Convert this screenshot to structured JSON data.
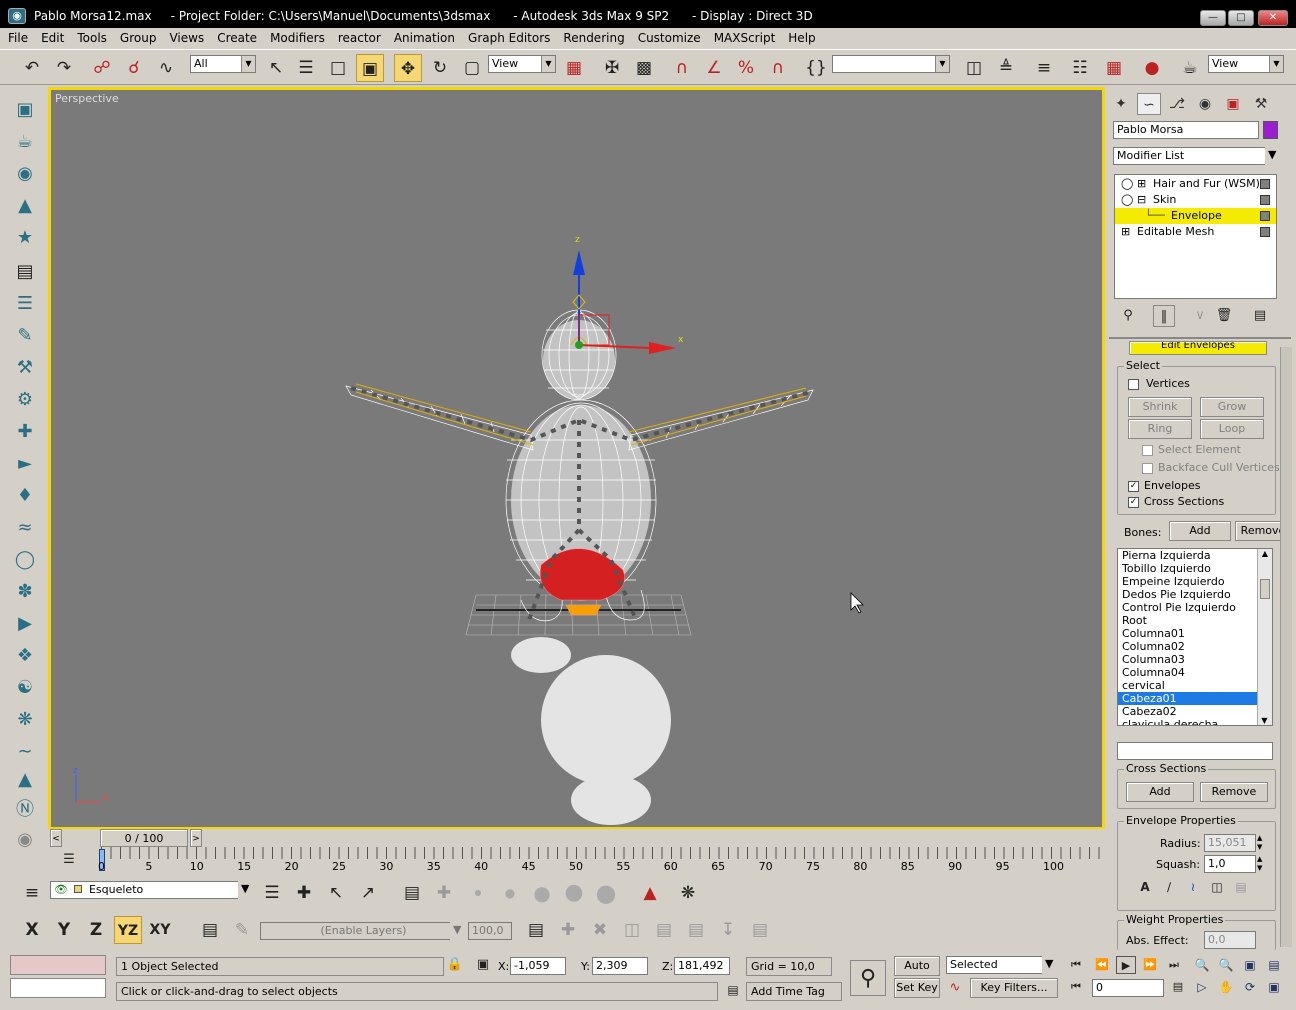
{
  "window": {
    "title": "Pablo Morsa12.max     - Project Folder: C:\\Users\\Manuel\\Documents\\3dsmax      - Autodesk 3ds Max 9 SP2      - Display : Direct 3D",
    "minimize": "—",
    "maximize": "□",
    "close": "✕"
  },
  "menu": [
    "File",
    "Edit",
    "Tools",
    "Group",
    "Views",
    "Create",
    "Modifiers",
    "reactor",
    "Animation",
    "Graph Editors",
    "Rendering",
    "Customize",
    "MAXScript",
    "Help"
  ],
  "toolbar": {
    "selection_filter": "All",
    "ref_coord": "View",
    "named_sel": "",
    "view_right": "View"
  },
  "viewport": {
    "label": "Perspective",
    "axis_z": "z",
    "axis_x": "x"
  },
  "timeslider": {
    "frame": "0 / 100",
    "prev": "<",
    "next": ">"
  },
  "timeline": {
    "ticks": [
      "0",
      "5",
      "10",
      "15",
      "20",
      "25",
      "30",
      "35",
      "40",
      "45",
      "50",
      "55",
      "60",
      "65",
      "70",
      "75",
      "80",
      "85",
      "90",
      "95",
      "100"
    ]
  },
  "layers": {
    "current": "Esqueleto"
  },
  "axis": {
    "x": "X",
    "y": "Y",
    "z": "Z",
    "yz": "YZ",
    "xy": "XY",
    "enable_layers": "(Enable Layers)",
    "percent": "100,0"
  },
  "status": {
    "selected": "1 Object Selected",
    "prompt": "Click or click-and-drag to select objects",
    "x_label": "X:",
    "x": "-1,059",
    "y_label": "Y:",
    "y": "2,309",
    "z_label": "Z:",
    "z": "181,492",
    "grid": "Grid = 10,0",
    "add_time_tag": "Add Time Tag",
    "auto_key": "Auto Key",
    "set_key": "Set Key",
    "key_mode": "Selected",
    "key_filters": "Key Filters...",
    "frame": "0"
  },
  "command_panel": {
    "object_name": "Pablo Morsa",
    "object_color": "#9b1fd1",
    "modifier_list": "Modifier List",
    "stack": [
      {
        "label": "Hair and Fur (WSM)"
      },
      {
        "label": "Skin"
      },
      {
        "label": "Envelope"
      },
      {
        "label": "Editable Mesh"
      }
    ],
    "edit_envelopes": "Edit Envelopes",
    "select_group": "Select",
    "vertices": "Vertices",
    "shrink": "Shrink",
    "grow": "Grow",
    "ring": "Ring",
    "loop": "Loop",
    "select_element": "Select Element",
    "backface": "Backface Cull Vertices",
    "envelopes": "Envelopes",
    "cross_sections": "Cross Sections",
    "bones_label": "Bones:",
    "add": "Add",
    "remove": "Remove",
    "bones": [
      "Pierna Izquierda",
      "Tobillo Izquierdo",
      "Empeine Izquierdo",
      "Dedos Pie Izquierdo",
      "Control Pie Izquierdo",
      "Root",
      "Columna01",
      "Columna02",
      "Columna03",
      "Columna04",
      "cervical",
      "Cabeza01",
      "Cabeza02",
      "clavicula derecha"
    ],
    "selected_bone": "Cabeza01",
    "cs_group": "Cross Sections",
    "cs_add": "Add",
    "cs_remove": "Remove",
    "env_props": "Envelope Properties",
    "radius_label": "Radius:",
    "radius": "15,051",
    "squash_label": "Squash:",
    "squash": "1,0",
    "weight_props": "Weight Properties",
    "abs_effect": "Abs. Effect:",
    "abs_value": "0,0"
  }
}
